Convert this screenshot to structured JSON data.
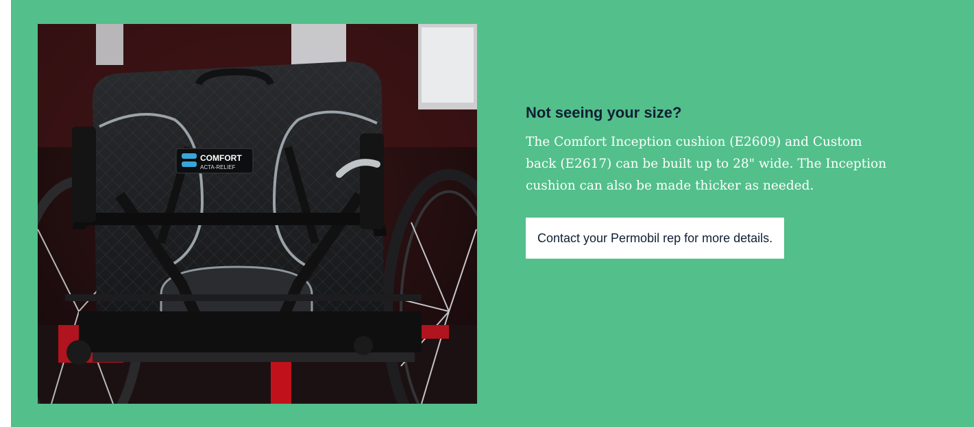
{
  "promo": {
    "image": {
      "logo_line1": "COMFORT",
      "logo_line2": "ACTA-RELIEF"
    },
    "heading": "Not seeing your size?",
    "body": "The Comfort Inception cushion (E2609) and Custom back (E2617) can be built  up to 28\" wide. The Inception cushion can also be made thicker as needed.",
    "cta_label": "Contact your Permobil rep for more details."
  },
  "colors": {
    "panel_background": "#53bf8b",
    "heading": "#0f1f33",
    "body_text": "#ffffff",
    "button_background": "#ffffff",
    "logo_accent": "#3aa6d8"
  }
}
